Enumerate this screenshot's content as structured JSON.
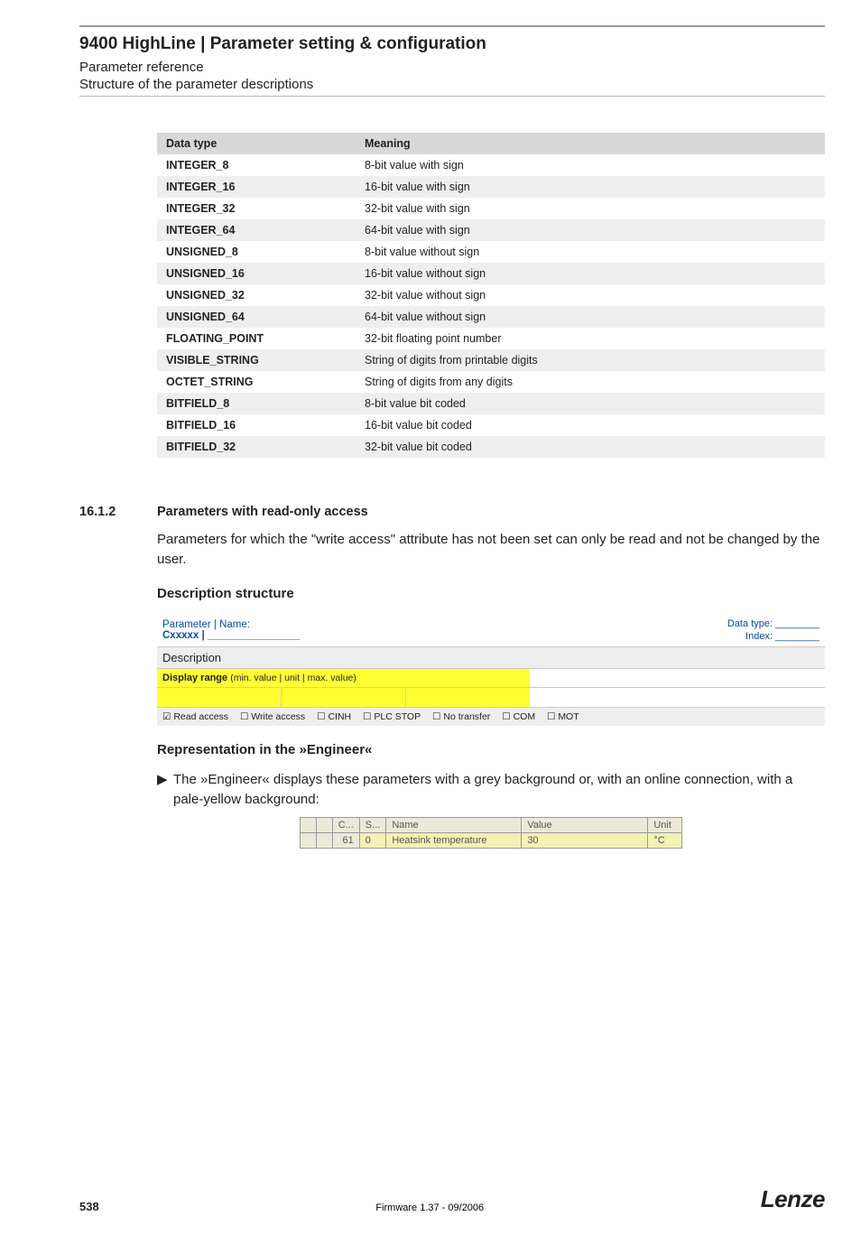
{
  "header": {
    "title": "9400 HighLine | Parameter setting & configuration",
    "sub1": "Parameter reference",
    "sub2": "Structure of the parameter descriptions"
  },
  "datatypes": {
    "header_type": "Data type",
    "header_meaning": "Meaning",
    "rows": [
      {
        "t": "INTEGER_8",
        "m": "8-bit value with sign"
      },
      {
        "t": "INTEGER_16",
        "m": "16-bit value with sign"
      },
      {
        "t": "INTEGER_32",
        "m": "32-bit value with sign"
      },
      {
        "t": "INTEGER_64",
        "m": "64-bit value with sign"
      },
      {
        "t": "UNSIGNED_8",
        "m": "8-bit value without sign"
      },
      {
        "t": "UNSIGNED_16",
        "m": "16-bit value without sign"
      },
      {
        "t": "UNSIGNED_32",
        "m": "32-bit value without sign"
      },
      {
        "t": "UNSIGNED_64",
        "m": "64-bit value without sign"
      },
      {
        "t": "FLOATING_POINT",
        "m": "32-bit floating point number"
      },
      {
        "t": "VISIBLE_STRING",
        "m": "String of digits from printable digits"
      },
      {
        "t": "OCTET_STRING",
        "m": "String of digits from any digits"
      },
      {
        "t": "BITFIELD_8",
        "m": "8-bit value bit coded"
      },
      {
        "t": "BITFIELD_16",
        "m": "16-bit value bit coded"
      },
      {
        "t": "BITFIELD_32",
        "m": "32-bit value bit coded"
      }
    ]
  },
  "section": {
    "num": "16.1.2",
    "title": "Parameters with read-only access",
    "para": "Parameters for which the \"write access\" attribute has not been set can only be read and not be changed by the user.",
    "desc_heading": "Description structure"
  },
  "desc": {
    "pname_label": "Parameter | Name:",
    "pname_code": "Cxxxxx | ________________",
    "dt_label": "Data type: ________",
    "idx_label": "Index: ________",
    "description": "Description",
    "display_range_bold": "Display range ",
    "display_range_small": "(min. value | unit | max. value)",
    "attrs": {
      "read": "☑ Read access",
      "write": "☐ Write access",
      "cinh": "☐ CINH",
      "plc": "☐ PLC STOP",
      "notr": "☐ No transfer",
      "com": "☐ COM",
      "mot": "☐ MOT"
    }
  },
  "engineer": {
    "heading": "Representation in the »Engineer«",
    "bullet": "The »Engineer« displays these parameters with a grey background or, with an online connection, with a pale-yellow background:",
    "cols": {
      "slash": " ",
      "c": "C...",
      "s": "S...",
      "name": "Name",
      "value": "Value",
      "unit": "Unit"
    },
    "row": {
      "slash": " ",
      "c": "61",
      "s": "0",
      "name": "Heatsink temperature",
      "value": "30",
      "unit": "°C"
    }
  },
  "footer": {
    "page": "538",
    "firmware": "Firmware 1.37 - 09/2006",
    "logo": "Lenze"
  }
}
